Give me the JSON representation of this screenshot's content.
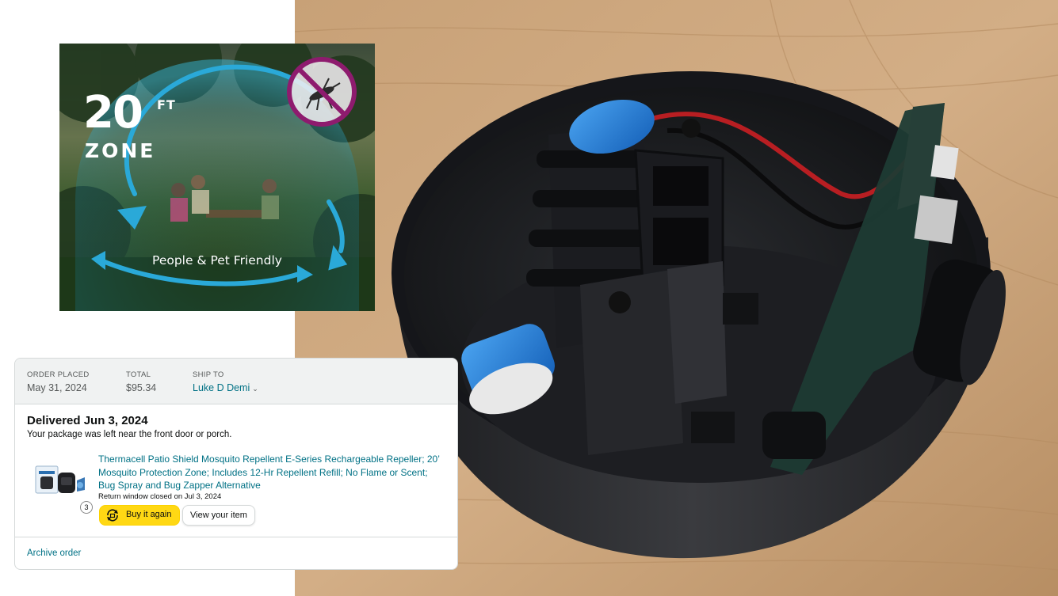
{
  "promo": {
    "distance": "20",
    "unit": "FT",
    "zone": "ZONE",
    "caption": "People & Pet Friendly"
  },
  "order": {
    "order_placed_label": "ORDER PLACED",
    "order_placed_value": "May 31, 2024",
    "total_label": "TOTAL",
    "total_value": "$95.34",
    "ship_to_label": "SHIP TO",
    "ship_to_value": "Luke D Demi",
    "status": "Delivered Jun 3, 2024",
    "status_detail": "Your package was left near the front door or porch.",
    "product_title": "Thermacell Patio Shield Mosquito Repellent E-Series Rechargeable Repeller; 20’ Mosquito Protection Zone; Includes 12-Hr Repellent Refill; No Flame or Scent; Bug Spray and Bug Zapper Alternative",
    "return_window": "Return window closed on Jul 3, 2024",
    "quantity": "3",
    "buy_again_label": "Buy it again",
    "view_item_label": "View your item",
    "archive_label": "Archive order"
  },
  "colors": {
    "link": "#007185",
    "buy_button": "#ffd814",
    "header_bg": "#f0f2f2",
    "no_mosquito_ring": "#8e1b6e",
    "zone_arrows": "#2aa9d8",
    "battery_blue": "#1e7fd6"
  },
  "icons": [
    "no-mosquito-icon",
    "chevron-down-icon",
    "buy-again-icon"
  ]
}
